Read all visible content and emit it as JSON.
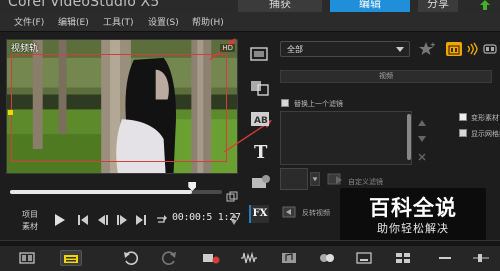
{
  "app": {
    "title": "Corel VideoStudio X5"
  },
  "steps": {
    "capture": "捕获",
    "edit": "编辑",
    "share": "分享"
  },
  "menu": [
    {
      "label": "文件(F)"
    },
    {
      "label": "编辑(E)"
    },
    {
      "label": "工具(T)"
    },
    {
      "label": "设置(S)"
    },
    {
      "label": "帮助(H)"
    }
  ],
  "preview": {
    "track_label": "视频轨",
    "corner_chip": "HD"
  },
  "playback": {
    "progress": 0.86,
    "mode_project": "项目",
    "mode_clip": "素材",
    "timecode": "00:00:5 1:27"
  },
  "options": {
    "category": "全部",
    "section_title": "视频",
    "replace_last_filter": "替换上一个滤镜",
    "customize_filter": "自定义滤镜",
    "reverse_video": "反转视频",
    "right_options": [
      "变形素材",
      "显示网格线"
    ]
  },
  "watermark": {
    "title": "百科全说",
    "subtitle": "助你轻松解决"
  },
  "colors": {
    "accent": "#1e8fd8",
    "highlight": "#f2a700",
    "annotation": "#d83b3b"
  }
}
